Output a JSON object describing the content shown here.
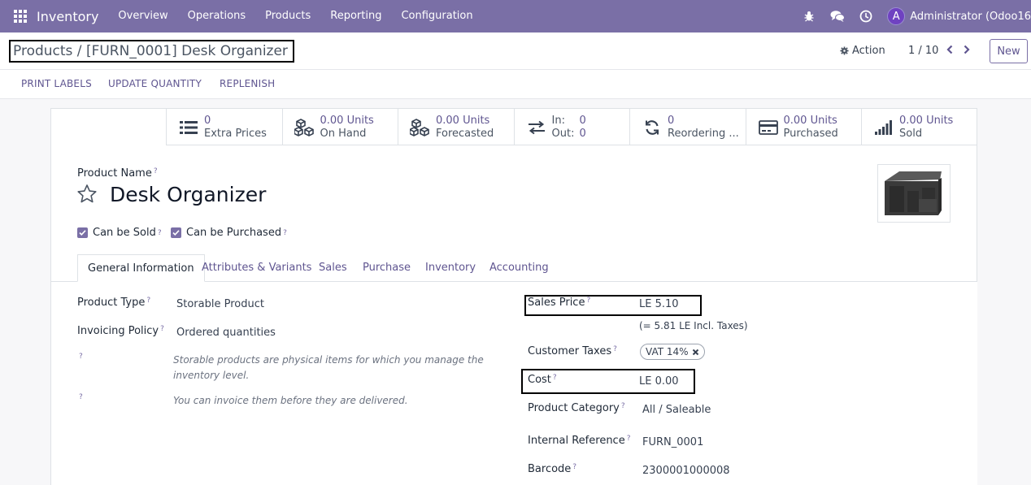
{
  "navbar": {
    "brand": "Inventory",
    "menu": [
      "Overview",
      "Operations",
      "Products",
      "Reporting",
      "Configuration"
    ],
    "avatar_letter": "A",
    "user": "Administrator (Odoo16"
  },
  "control": {
    "breadcrumb": "Products / [FURN_0001] Desk Organizer",
    "action_label": "Action",
    "pager": "1 / 10",
    "new_label": "New"
  },
  "statusbar": {
    "buttons": [
      "PRINT LABELS",
      "UPDATE QUANTITY",
      "REPLENISH"
    ]
  },
  "smart_buttons": [
    {
      "value": "0",
      "label": "Extra Prices",
      "icon": "list-icon"
    },
    {
      "value": "0.00 Units",
      "label": "On Hand",
      "icon": "cubes-icon"
    },
    {
      "value": "0.00 Units",
      "label": "Forecasted",
      "icon": "cubes-icon"
    },
    {
      "in_label": "In:",
      "in_value": "0",
      "out_label": "Out:",
      "out_value": "0",
      "icon": "exchange-icon"
    },
    {
      "value": "0",
      "label": "Reordering ...",
      "icon": "refresh-icon"
    },
    {
      "value": "0.00 Units",
      "label": "Purchased",
      "icon": "credit-card-icon"
    },
    {
      "value": "0.00 Units",
      "label": "Sold",
      "icon": "signal-icon"
    }
  ],
  "product": {
    "name_label": "Product Name",
    "name": "Desk Organizer",
    "can_be_sold": "Can be Sold",
    "can_be_purchased": "Can be Purchased",
    "help_mark": "?"
  },
  "tabs": [
    "General Information",
    "Attributes & Variants",
    "Sales",
    "Purchase",
    "Inventory",
    "Accounting"
  ],
  "left_fields": {
    "product_type_label": "Product Type",
    "product_type": "Storable Product",
    "invoicing_policy_label": "Invoicing Policy",
    "invoicing_policy": "Ordered quantities",
    "hint1_line1": "Storable products are physical items for which you manage the",
    "hint1_line2": "inventory level.",
    "hint2": "You can invoice them before they are delivered."
  },
  "right_fields": {
    "sales_price_label": "Sales Price",
    "sales_price": "LE 5.10",
    "incl_taxes": "(= 5.81 LE Incl. Taxes)",
    "customer_taxes_label": "Customer Taxes",
    "tax_tag": "VAT 14%",
    "cost_label": "Cost",
    "cost": "LE 0.00",
    "category_label": "Product Category",
    "category": "All / Saleable",
    "internal_ref_label": "Internal Reference",
    "internal_ref": "FURN_0001",
    "barcode_label": "Barcode",
    "barcode": "2300001000008"
  },
  "colors": {
    "navbar": "#7a6fa6",
    "accent": "#5f5590"
  }
}
